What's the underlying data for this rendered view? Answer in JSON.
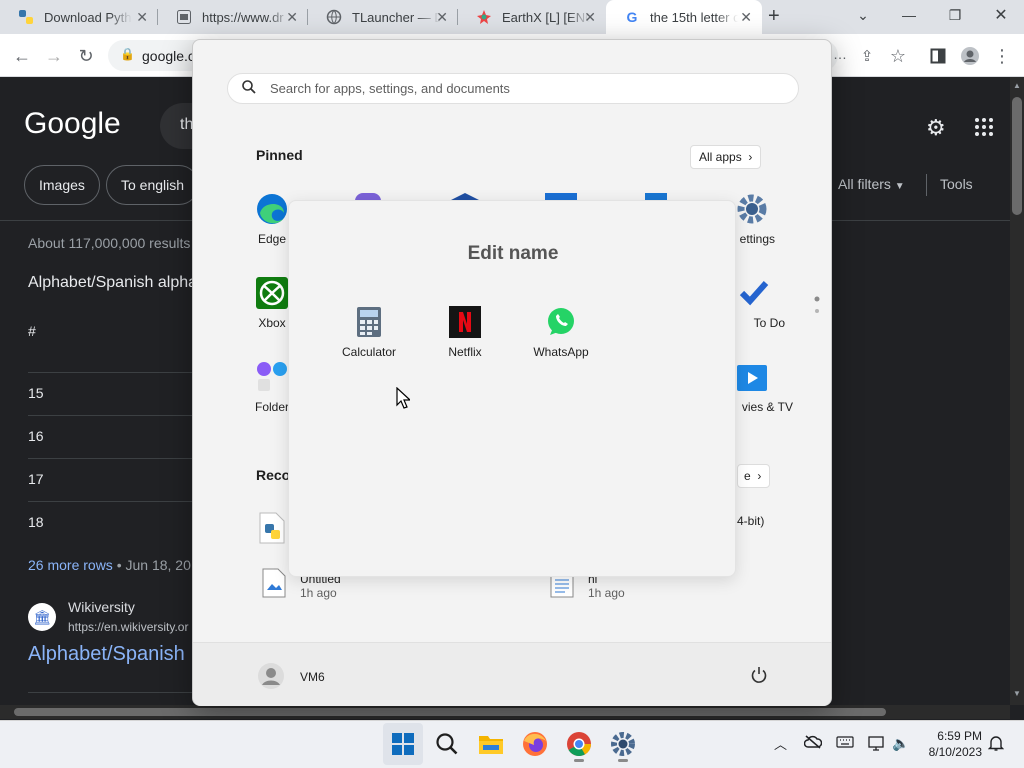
{
  "browser": {
    "tabs": [
      {
        "title": "Download Pyth"
      },
      {
        "title": "https://www.dr"
      },
      {
        "title": "TLauncher — D"
      },
      {
        "title": "EarthX [L] [ENG"
      },
      {
        "title": "the 15th letter c"
      }
    ],
    "new_tab": "+",
    "url": "google.c"
  },
  "google": {
    "logo": "Google",
    "query_fragment": "th",
    "chips": [
      "Images",
      "To english"
    ],
    "all_filters": "All filters",
    "tools": "Tools",
    "result_stats": "About 117,000,000 results",
    "snippet_title": "Alphabet/Spanish alpha",
    "table_header": "#",
    "rows": [
      "15",
      "16",
      "17",
      "18"
    ],
    "more_rows": "26 more rows",
    "more_rows_date": "• Jun 18, 20",
    "source_name": "Wikiversity",
    "source_url": "https://en.wikiversity.or",
    "result_link": "Alphabet/Spanish"
  },
  "start_menu": {
    "search_placeholder": "Search for apps, settings, and documents",
    "pinned_label": "Pinned",
    "all_apps": "All apps",
    "pinned_visible": {
      "edge": "Edge",
      "settings": "ettings",
      "xbox": "Xbox",
      "todo": "To Do",
      "folder": "Folder",
      "movies": "vies & TV"
    },
    "recommended_label": "Reco",
    "more_btn": "e",
    "recommended": [
      {
        "name": "Untitled",
        "time": "1h ago"
      },
      {
        "name": "hi",
        "time": "1h ago"
      },
      {
        "name": "4-bit)"
      }
    ],
    "user": "VM6",
    "folder": {
      "title": "Edit name",
      "apps": [
        "Calculator",
        "Netflix",
        "WhatsApp"
      ]
    }
  },
  "taskbar": {
    "time": "6:59 PM",
    "date": "8/10/2023"
  }
}
